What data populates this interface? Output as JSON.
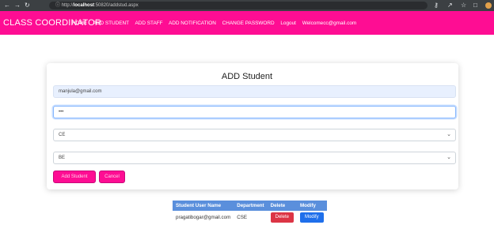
{
  "browser": {
    "url_prefix": "http://",
    "url_host": "localhost",
    "url_path": ":50820/addstud.aspx"
  },
  "navbar": {
    "brand": "CLASS COORDINATOR",
    "links": [
      "HOME",
      "ADD STUDENT",
      "ADD STAFF",
      "ADD NOTIFICATION",
      "CHANGE PASSWORD",
      "Logout"
    ],
    "welcome": "Welcomecc@gmail.com"
  },
  "form": {
    "title": "ADD Student",
    "email_value": "manjula@gmail.com",
    "password_value": "•••",
    "department_value": "CE",
    "semester_value": "BE",
    "add_label": "Add Student",
    "cancel_label": "Cancel"
  },
  "table": {
    "headers": [
      "Student User Name",
      "Department",
      "Delete",
      "Modify"
    ],
    "rows": [
      {
        "username": "pragatibogar@gmail.com",
        "department": "CSE",
        "delete": "Delete",
        "modify": "Modify"
      }
    ]
  },
  "colors": {
    "brand": "#fe0d93",
    "table_header": "#5a8fdc",
    "delete": "#dc3545",
    "modify": "#1f6feb"
  }
}
